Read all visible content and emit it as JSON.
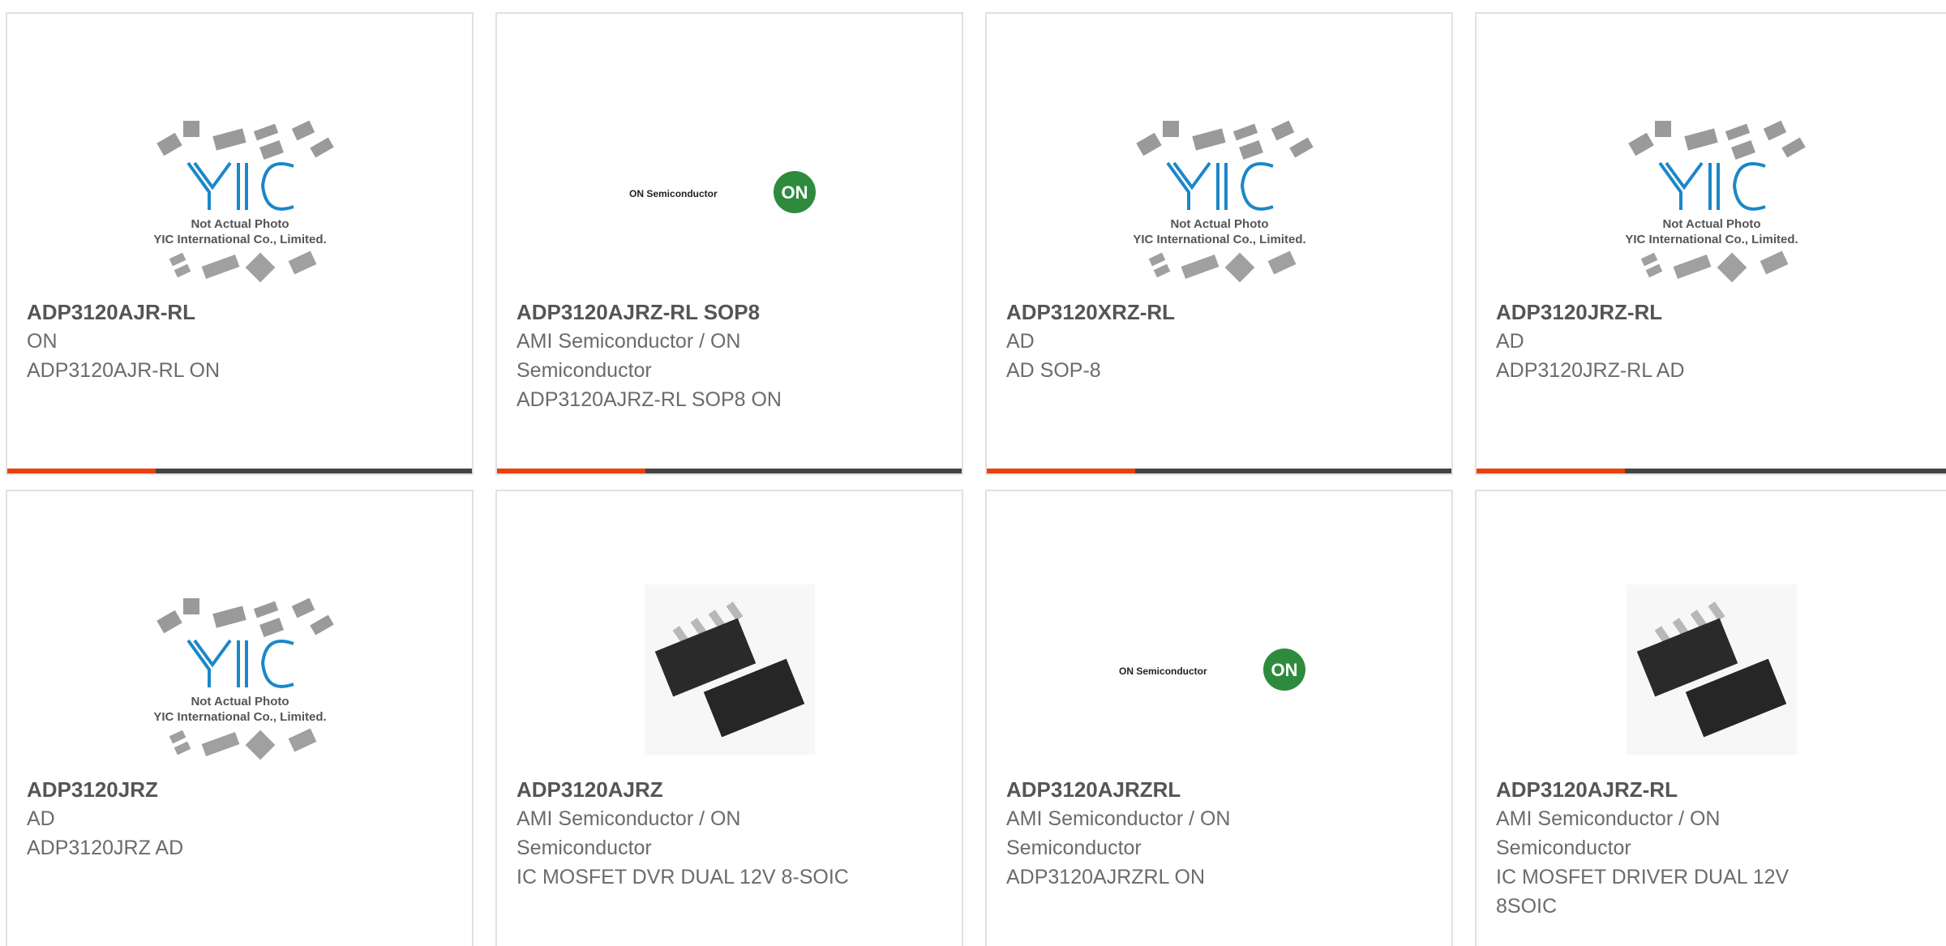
{
  "placeholder": {
    "logo_text": "YIC",
    "line1": "Not Actual Photo",
    "line2": "YIC International Co., Limited."
  },
  "on_logo": {
    "text": "ON Semiconductor",
    "badge": "ON"
  },
  "colors": {
    "accent": "#e8410c",
    "bar_dark": "#444444",
    "logo_blue": "#1b87c9",
    "on_green": "#2e8b3e"
  },
  "cards": [
    {
      "title": "ADP3120AJR-RL",
      "brand": "ON",
      "desc": "ADP3120AJR-RL ON",
      "image": "yic-placeholder"
    },
    {
      "title": "ADP3120AJRZ-RL SOP8",
      "brand": "AMI Semiconductor / ON Semiconductor",
      "desc": "ADP3120AJRZ-RL SOP8 ON",
      "image": "on-semiconductor-logo"
    },
    {
      "title": "ADP3120XRZ-RL",
      "brand": "AD",
      "desc": "AD SOP-8",
      "image": "yic-placeholder"
    },
    {
      "title": "ADP3120JRZ-RL",
      "brand": "AD",
      "desc": "ADP3120JRZ-RL AD",
      "image": "yic-placeholder"
    },
    {
      "title": "ADP3120JRZ",
      "brand": "AD",
      "desc": "ADP3120JRZ AD",
      "image": "yic-placeholder"
    },
    {
      "title": "ADP3120AJRZ",
      "brand": "AMI Semiconductor / ON Semiconductor",
      "desc": "IC MOSFET DVR DUAL 12V 8-SOIC",
      "image": "soic8-chip-photo"
    },
    {
      "title": "ADP3120AJRZRL",
      "brand": "AMI Semiconductor / ON Semiconductor",
      "desc": "ADP3120AJRZRL ON",
      "image": "on-semiconductor-logo"
    },
    {
      "title": "ADP3120AJRZ-RL",
      "brand": "AMI Semiconductor / ON Semiconductor",
      "desc": "IC MOSFET DRIVER DUAL 12V 8SOIC",
      "image": "soic8-chip-photo"
    }
  ]
}
